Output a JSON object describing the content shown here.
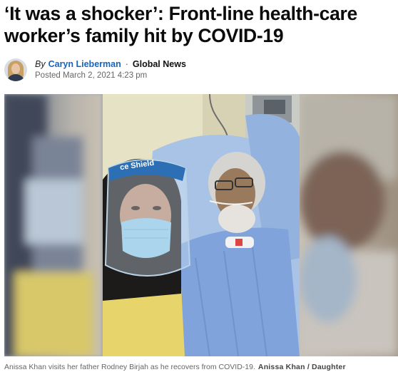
{
  "article": {
    "headline": "‘It was a shocker’: Front-line health-care worker’s family hit by COVID-19",
    "byline": {
      "prefix": "By",
      "author": "Caryn Lieberman",
      "separator": "·",
      "outlet": "Global News",
      "posted": "Posted March 2, 2021 4:23 pm"
    },
    "image": {
      "caption": "Anissa Khan visits her father Rodney Birjah as he recovers from COVID-19.",
      "credit": "Anissa Khan / Daughter",
      "shield_label": "ce Shield"
    }
  },
  "colors": {
    "author_link": "#1565c0",
    "headline": "#0b0b0b",
    "caption": "#666666"
  }
}
